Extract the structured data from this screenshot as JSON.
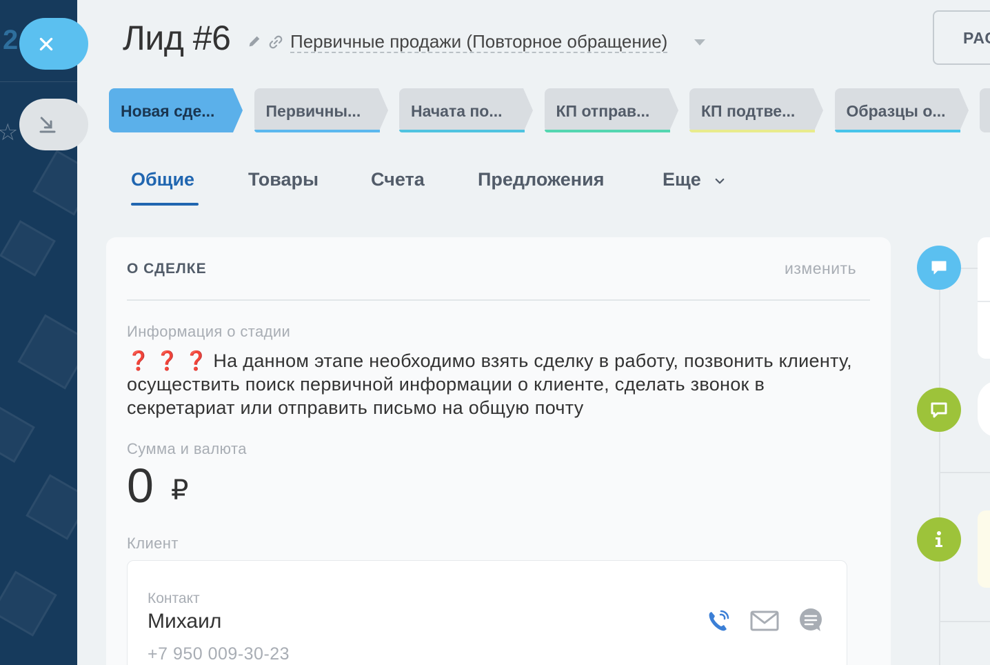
{
  "sidebar": {
    "strip_number": "2",
    "close_label": "×"
  },
  "header": {
    "title": "Лид #6",
    "category": "Первичные продажи (Повторное обращение)",
    "top_right_button": "РАС"
  },
  "stages": [
    {
      "label": "Новая сде...",
      "color": "#5bb0ea",
      "bar": "#5bb0ea",
      "active": true
    },
    {
      "label": "Первичны...",
      "color": "#d9dde1",
      "bar": "#5bb8ee",
      "active": false
    },
    {
      "label": "Начата по...",
      "color": "#d9dde1",
      "bar": "#4fc3e0",
      "active": false
    },
    {
      "label": "КП отправ...",
      "color": "#d9dde1",
      "bar": "#54d6b0",
      "active": false
    },
    {
      "label": "КП подтве...",
      "color": "#d9dde1",
      "bar": "#e8eb8c",
      "active": false
    },
    {
      "label": "Образцы о...",
      "color": "#d9dde1",
      "bar": "#47c4ea",
      "active": false
    }
  ],
  "tabs": [
    {
      "label": "Общие",
      "active": true
    },
    {
      "label": "Товары",
      "active": false
    },
    {
      "label": "Счета",
      "active": false
    },
    {
      "label": "Предложения",
      "active": false
    },
    {
      "label": "Еще",
      "active": false
    }
  ],
  "deal": {
    "section_title": "О СДЕЛКЕ",
    "edit_label": "изменить",
    "stage_info_label": "Информация о стадии",
    "stage_info_marks": "❓ ❓ ❓",
    "stage_info_text": "На данном этапе необходимо взять сделку в работу, позвонить клиенту, осуществить поиск первичной информации о клиенте, сделать звонок в секретариат или отправить письмо на общую почту",
    "sum_label": "Сумма и валюта",
    "sum_value": "0",
    "sum_currency": "₽",
    "client_label": "Клиент",
    "contact_label": "Контакт",
    "contact_name": "Михаил",
    "contact_phone": "+7 950 009-30-23"
  },
  "colors": {
    "accent": "#2066b0",
    "close_button": "#5bc0f0",
    "timeline_blue": "#5bc0f0",
    "timeline_green": "#9dc33a",
    "phone_icon": "#3b7fd6"
  },
  "icons": [
    "close-icon",
    "minimize-icon",
    "pencil-icon",
    "link-icon",
    "chevron-down-icon",
    "phone-icon",
    "mail-icon",
    "chat-icon",
    "comment-icon",
    "message-icon",
    "info-icon"
  ]
}
